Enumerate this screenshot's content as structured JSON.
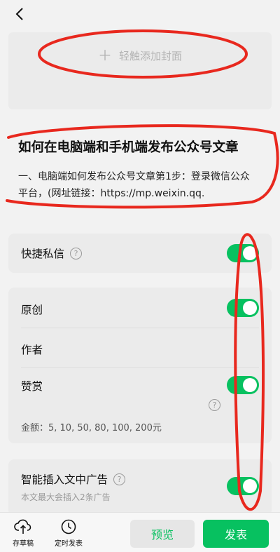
{
  "header": {
    "back_icon": "chevron-left-icon"
  },
  "cover": {
    "add_label": "轻触添加封面",
    "add_icon": "plus-icon"
  },
  "article": {
    "title": "如何在电脑端和手机端发布公众号文章",
    "excerpt_line1": "一、电脑端如何发布公众号文章第1步：登录微信公众",
    "excerpt_line2": "平台，(网址链接：https://mp.weixin.qq."
  },
  "settings": {
    "quick_message": {
      "label": "快捷私信",
      "help": "?",
      "enabled": true
    },
    "original": {
      "label": "原创",
      "enabled": true
    },
    "author": {
      "label": "作者",
      "value": ""
    },
    "reward": {
      "label": "赞赏",
      "enabled": true,
      "help": "?",
      "amounts": "金额：5, 10, 50, 80, 100, 200元"
    },
    "smart_ads": {
      "label": "智能插入文中广告",
      "help": "?",
      "enabled": true,
      "note": "本文最大会插入2条广告"
    }
  },
  "bottom": {
    "save_draft": {
      "label": "存草稿",
      "icon": "cloud-upload-icon"
    },
    "schedule": {
      "label": "定时发表",
      "icon": "clock-icon"
    },
    "preview": "预览",
    "publish": "发表"
  },
  "colors": {
    "accent": "#07c160",
    "annotation": "#e8281e",
    "background": "#f2f2f2"
  }
}
